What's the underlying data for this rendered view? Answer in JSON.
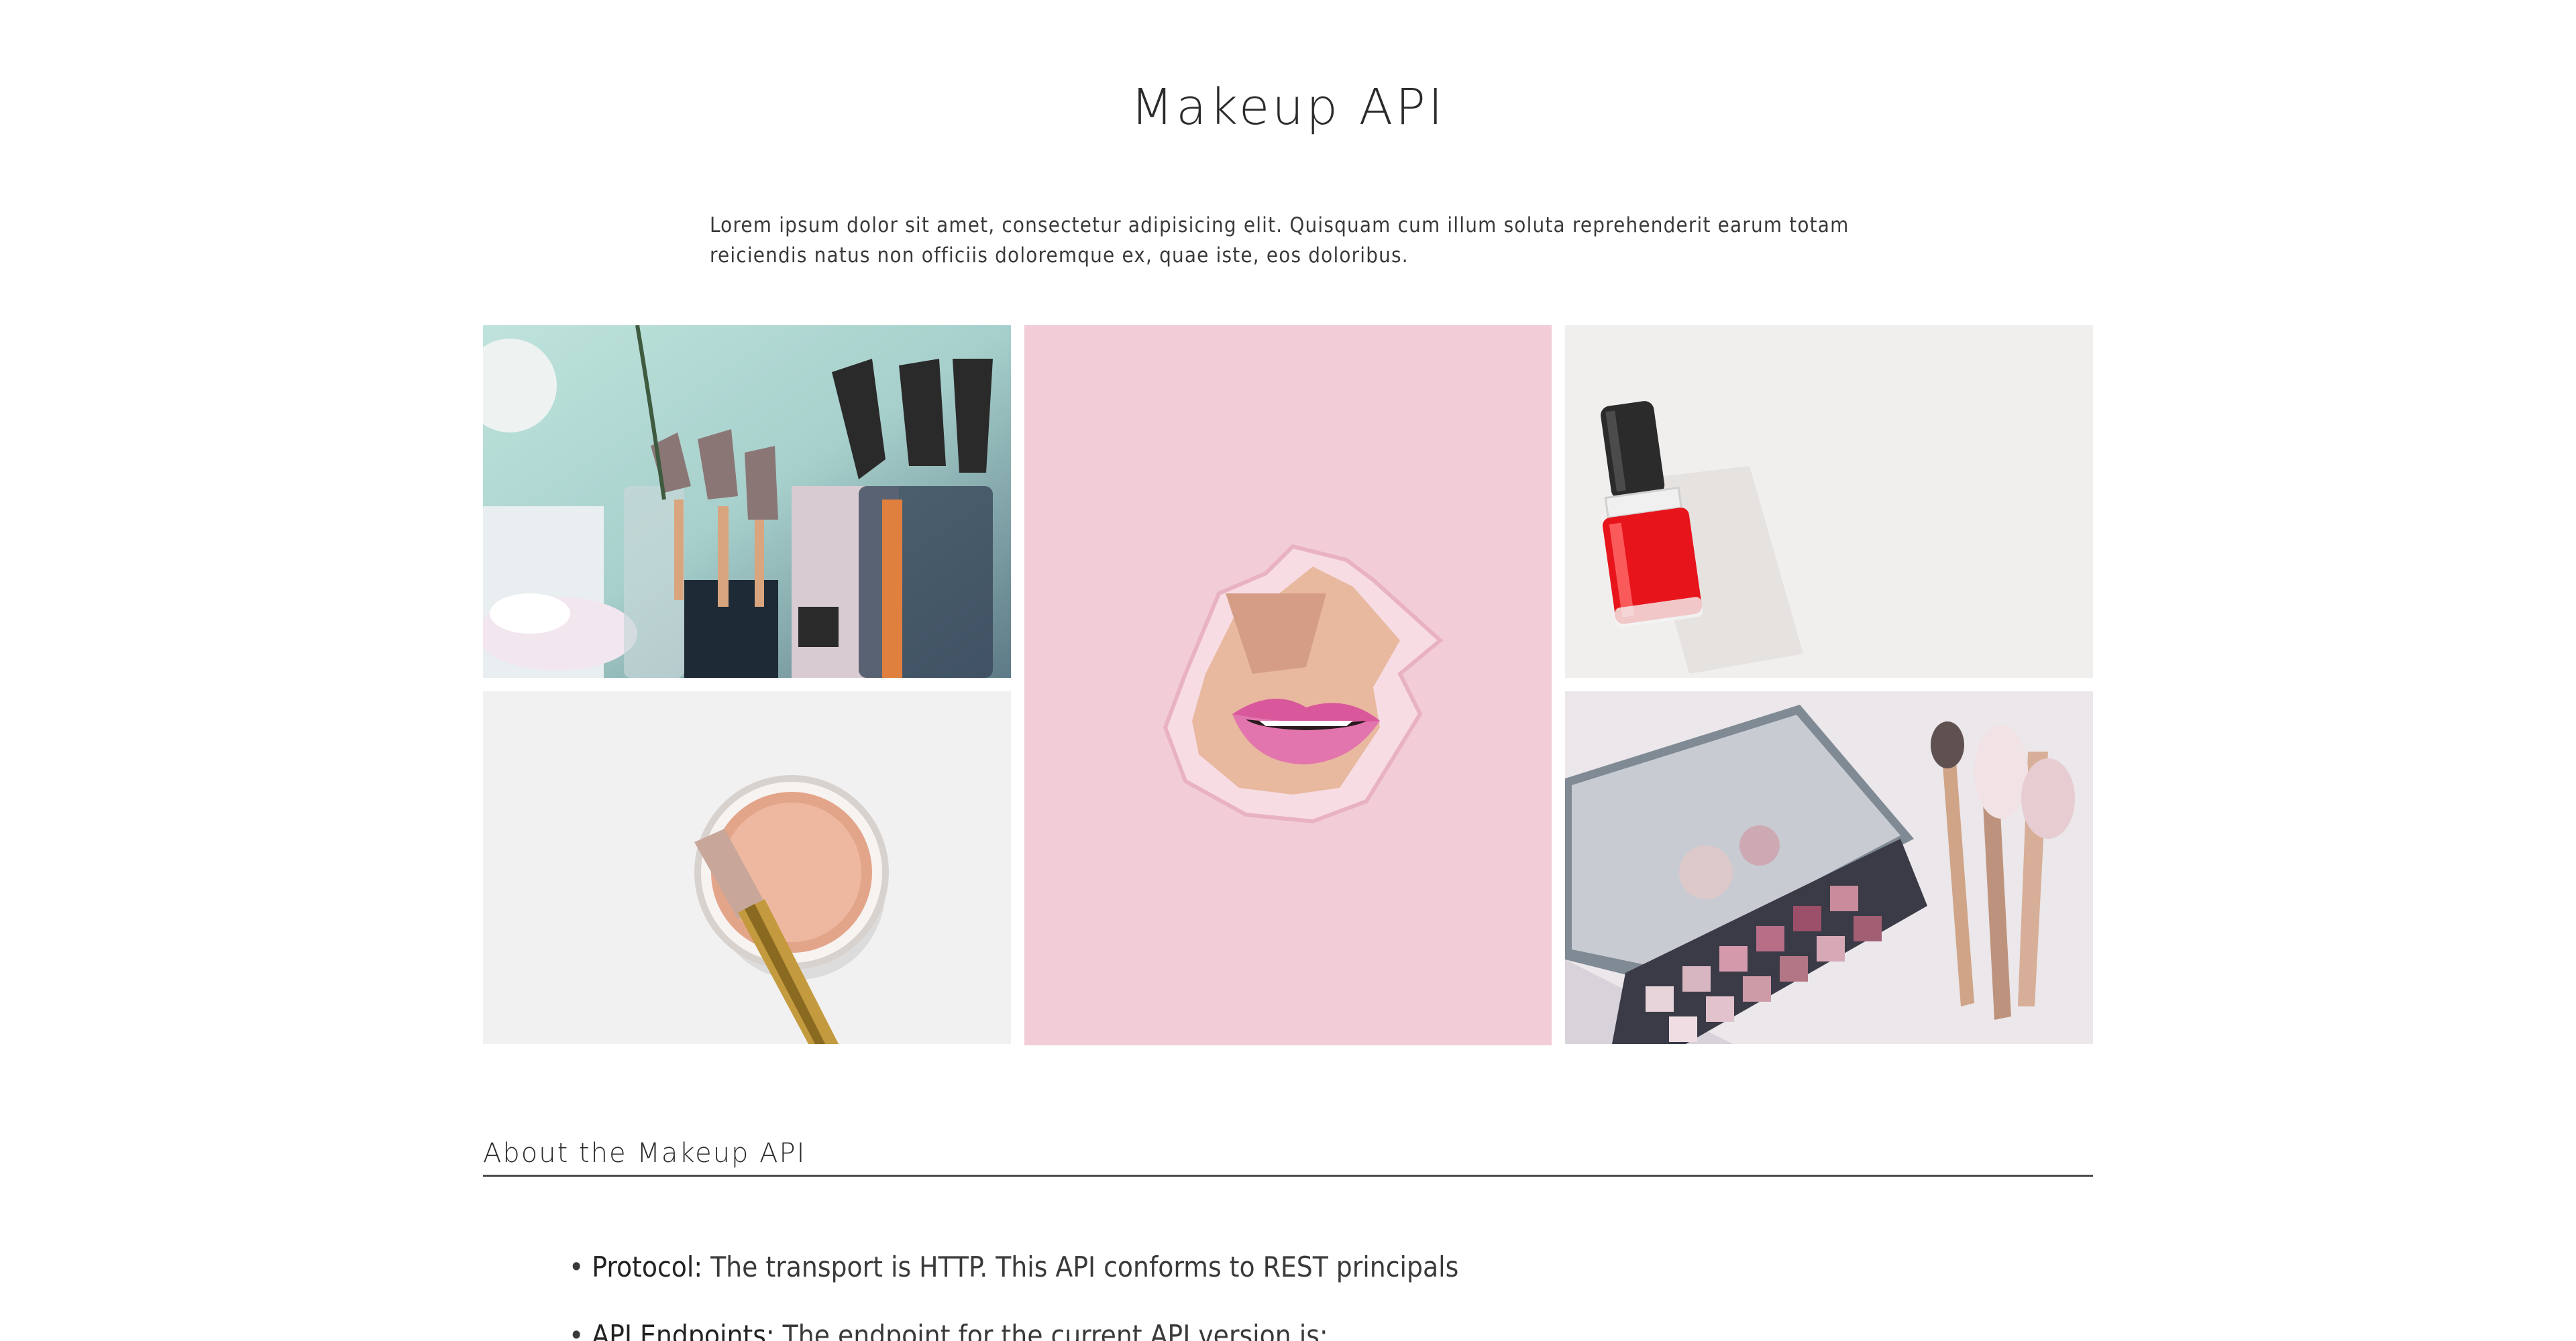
{
  "page": {
    "title": "Makeup API",
    "intro": "Lorem ipsum dolor sit amet, consectetur adipisicing elit. Quisquam cum illum soluta reprehenderit earum totam reiciendis natus non officiis doloremque ex, quae iste, eos doloribus."
  },
  "gallery": {
    "images": [
      {
        "name": "makeup-brushes-photo",
        "icon": "makeup-brushes"
      },
      {
        "name": "blush-powder-photo",
        "icon": "powder-brush"
      },
      {
        "name": "pink-lips-photo",
        "icon": "lips"
      },
      {
        "name": "nail-polish-photo",
        "icon": "nail-polish"
      },
      {
        "name": "eyeshadow-palette-photo",
        "icon": "eyeshadow-palette"
      }
    ]
  },
  "about": {
    "heading": "About the Makeup API",
    "items": [
      {
        "term": "Protocol:",
        "text": " The transport is HTTP. This API conforms to REST principals"
      },
      {
        "term": "API Endpoints:",
        "text": " The endpoint for the current API version is:"
      }
    ]
  },
  "colors": {
    "text": "#2b2b2b",
    "divider": "#4a4a4a",
    "lips_bg": "#f2cdd7",
    "polish_red": "#e8141c"
  }
}
